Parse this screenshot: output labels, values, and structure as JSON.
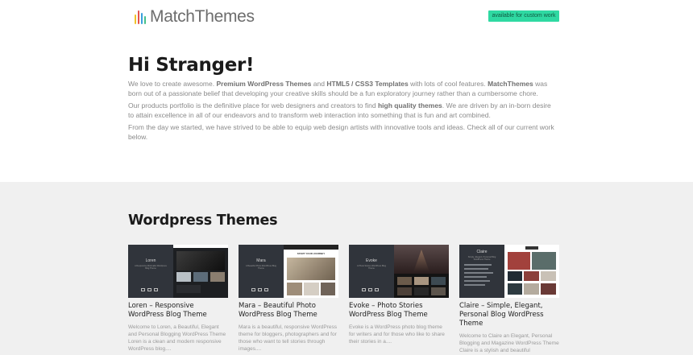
{
  "header": {
    "logo_text": "MatchThemes",
    "badge_label": "available for custom work",
    "colors": {
      "badge_bg": "#2fd9a2"
    }
  },
  "intro": {
    "heading": "Hi Stranger!",
    "p1": {
      "t1": "We love to create awesome.",
      "b1": "Premium WordPress Themes",
      "t2": "and",
      "b2": "HTML5 / CSS3 Templates",
      "t3": "with lots of cool features.",
      "b3": "MatchThemes",
      "t4": "was born out of a passionate belief that developing your creative skills should be a fun exploratory journey rather than a cumbersome chore."
    },
    "p2": {
      "t1": "Our products portfolio is the definitive place for web designers and creators to find",
      "b1": "high quality themes",
      "t2": ". We are driven by an in-born desire to attain excellence in all of our endeavors and to transform web interaction into something that is fun and art combined."
    },
    "p3": "From the day we started, we have strived to be able to equip web design artists with innovative tools and ideas. Check all of our current work below."
  },
  "themes": {
    "section_title": "Wordpress Themes",
    "cards": [
      {
        "thumb_name": "Loren",
        "thumb_sub": "A Responsive Minimalist Wordpress Blog Theme",
        "title": "Loren – Responsive WordPress Blog Theme",
        "desc": "Welcome to Loren, a Beautiful, Elegant and Personal Blogging WordPress Theme Loren is a clean and modern responsive WordPress blog...."
      },
      {
        "thumb_name": "Mara",
        "thumb_sub": "A Beautiful Photo WordPress Blog Theme",
        "thumb_banner": "START YOUR JOURNEY",
        "title": "Mara – Beautiful Photo WordPress Blog Theme",
        "desc": "Mara is a beautiful, responsive WordPress theme for bloggers, photographers and for those who want to tell stories through images...."
      },
      {
        "thumb_name": "Evoke",
        "thumb_sub": "A Photo Stories WordPress Blog Theme",
        "title": "Evoke – Photo Stories WordPress Blog Theme",
        "desc": "Evoke is a WordPress photo blog theme for writers and for those who like to share their stories in a...."
      },
      {
        "thumb_name": "Claire",
        "thumb_sub": "Simple, Elegant, Personal Blog WordPress Theme",
        "title": "Claire – Simple, Elegant, Personal Blog WordPress Theme",
        "desc": "Welcome to Claire an Elegant, Personal Blogging and Magazine WordPress Theme Claire is a stylish and beautiful"
      }
    ]
  }
}
